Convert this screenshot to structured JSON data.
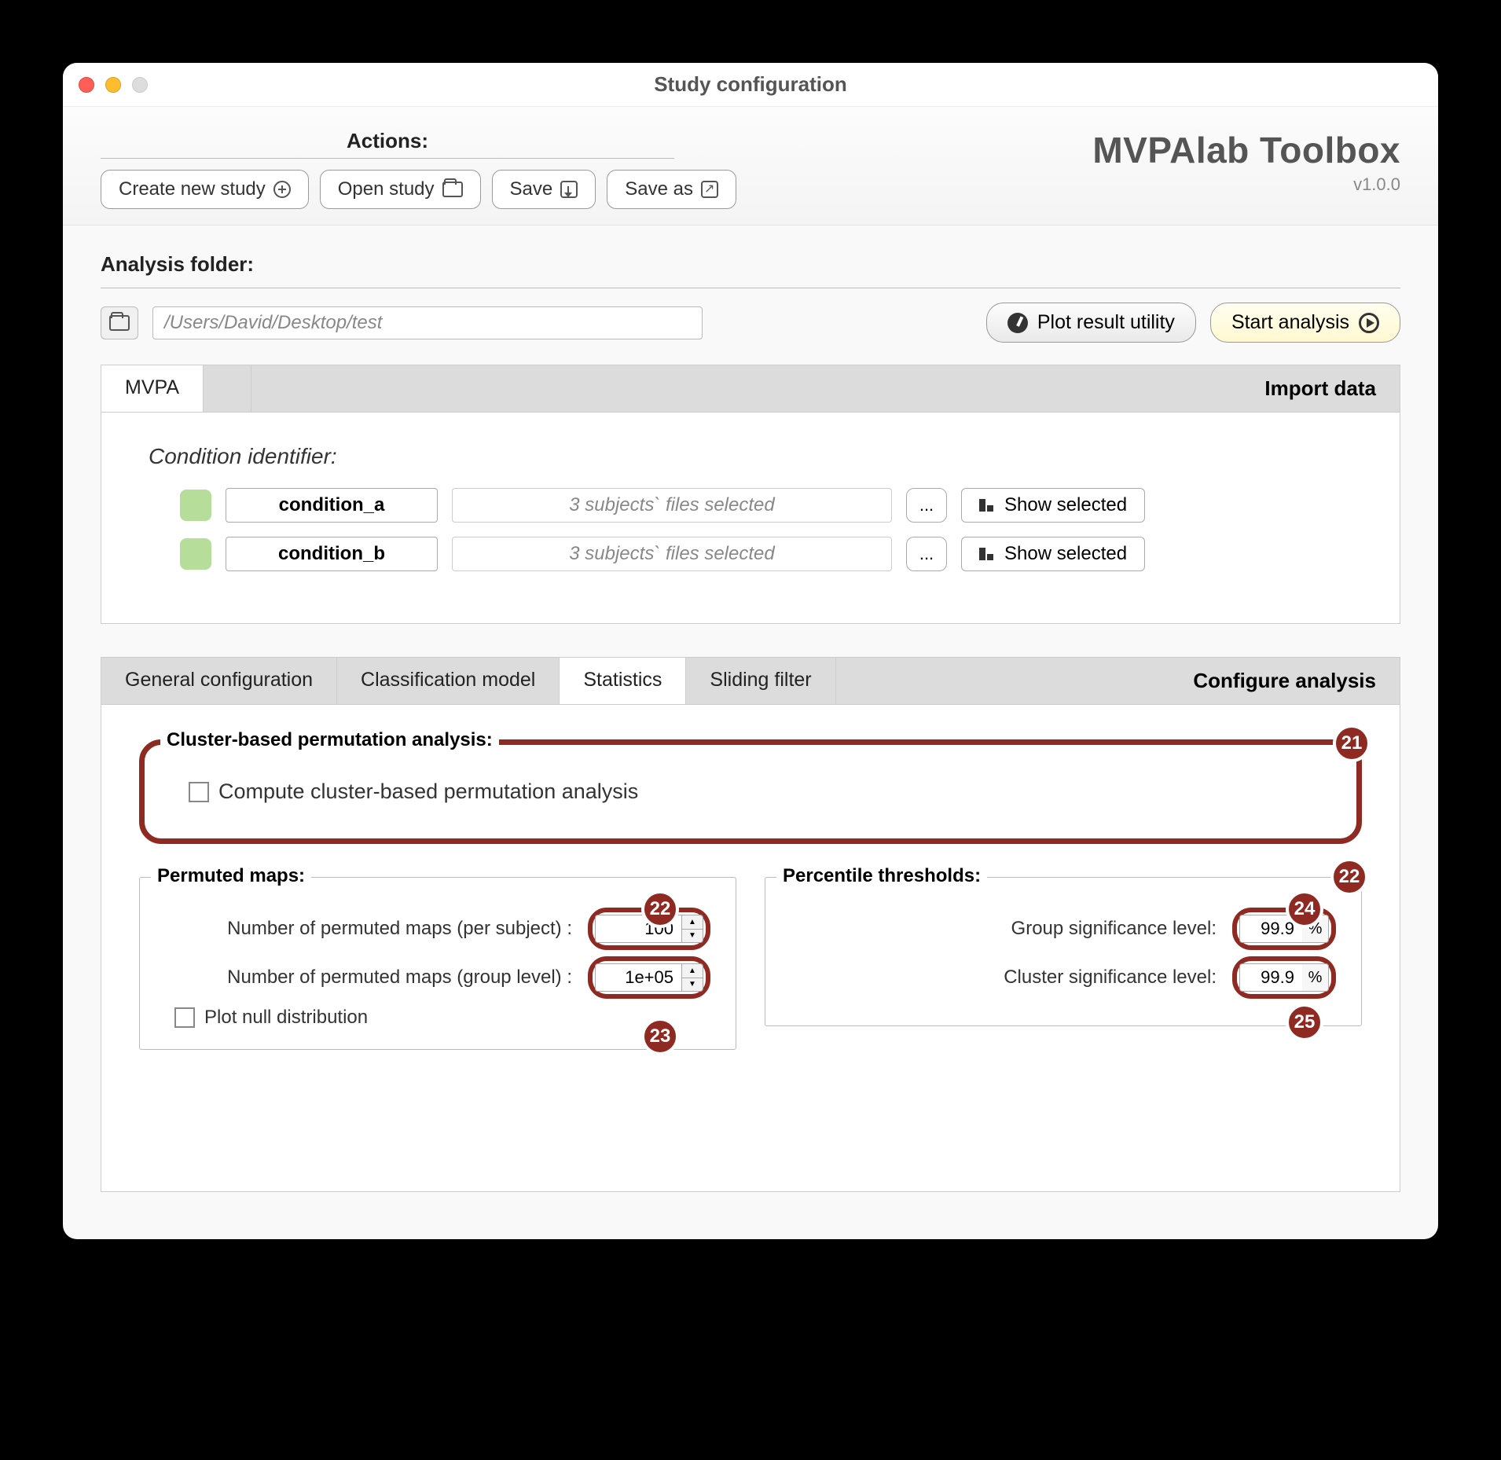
{
  "window": {
    "title": "Study configuration"
  },
  "brand": {
    "name": "MVPAlab Toolbox",
    "version": "v1.0.0"
  },
  "actions": {
    "label": "Actions:",
    "create": "Create new study",
    "open": "Open study",
    "save": "Save",
    "saveas": "Save as"
  },
  "folder": {
    "label": "Analysis folder:",
    "path": "/Users/David/Desktop/test",
    "plot_btn": "Plot result utility",
    "start_btn": "Start analysis"
  },
  "import": {
    "tab": "MVPA",
    "panel_title": "Import data",
    "cond_label": "Condition identifier:",
    "rows": [
      {
        "name": "condition_a",
        "info": "3 subjects` files selected",
        "show": "Show selected",
        "dots": "..."
      },
      {
        "name": "condition_b",
        "info": "3 subjects` files selected",
        "show": "Show selected",
        "dots": "..."
      }
    ]
  },
  "config": {
    "tabs": {
      "general": "General configuration",
      "model": "Classification model",
      "stats": "Statistics",
      "sliding": "Sliding filter"
    },
    "panel_title": "Configure analysis",
    "cluster": {
      "legend": "Cluster-based permutation analysis:",
      "checkbox": "Compute cluster-based permutation analysis"
    },
    "permuted": {
      "legend": "Permuted maps:",
      "per_subject_label": "Number of permuted maps (per subject) :",
      "per_subject_value": "100",
      "group_label": "Number of permuted maps (group level) :",
      "group_value": "1e+05",
      "plot_null": "Plot null distribution"
    },
    "percentile": {
      "legend": "Percentile thresholds:",
      "group_sig_label": "Group significance level:",
      "group_sig_value": "99.9",
      "cluster_sig_label": "Cluster significance level:",
      "cluster_sig_value": "99.9",
      "pct": "%"
    }
  },
  "callouts": {
    "c21": "21",
    "c22a": "22",
    "c22b": "22",
    "c23": "23",
    "c24": "24",
    "c25": "25"
  }
}
